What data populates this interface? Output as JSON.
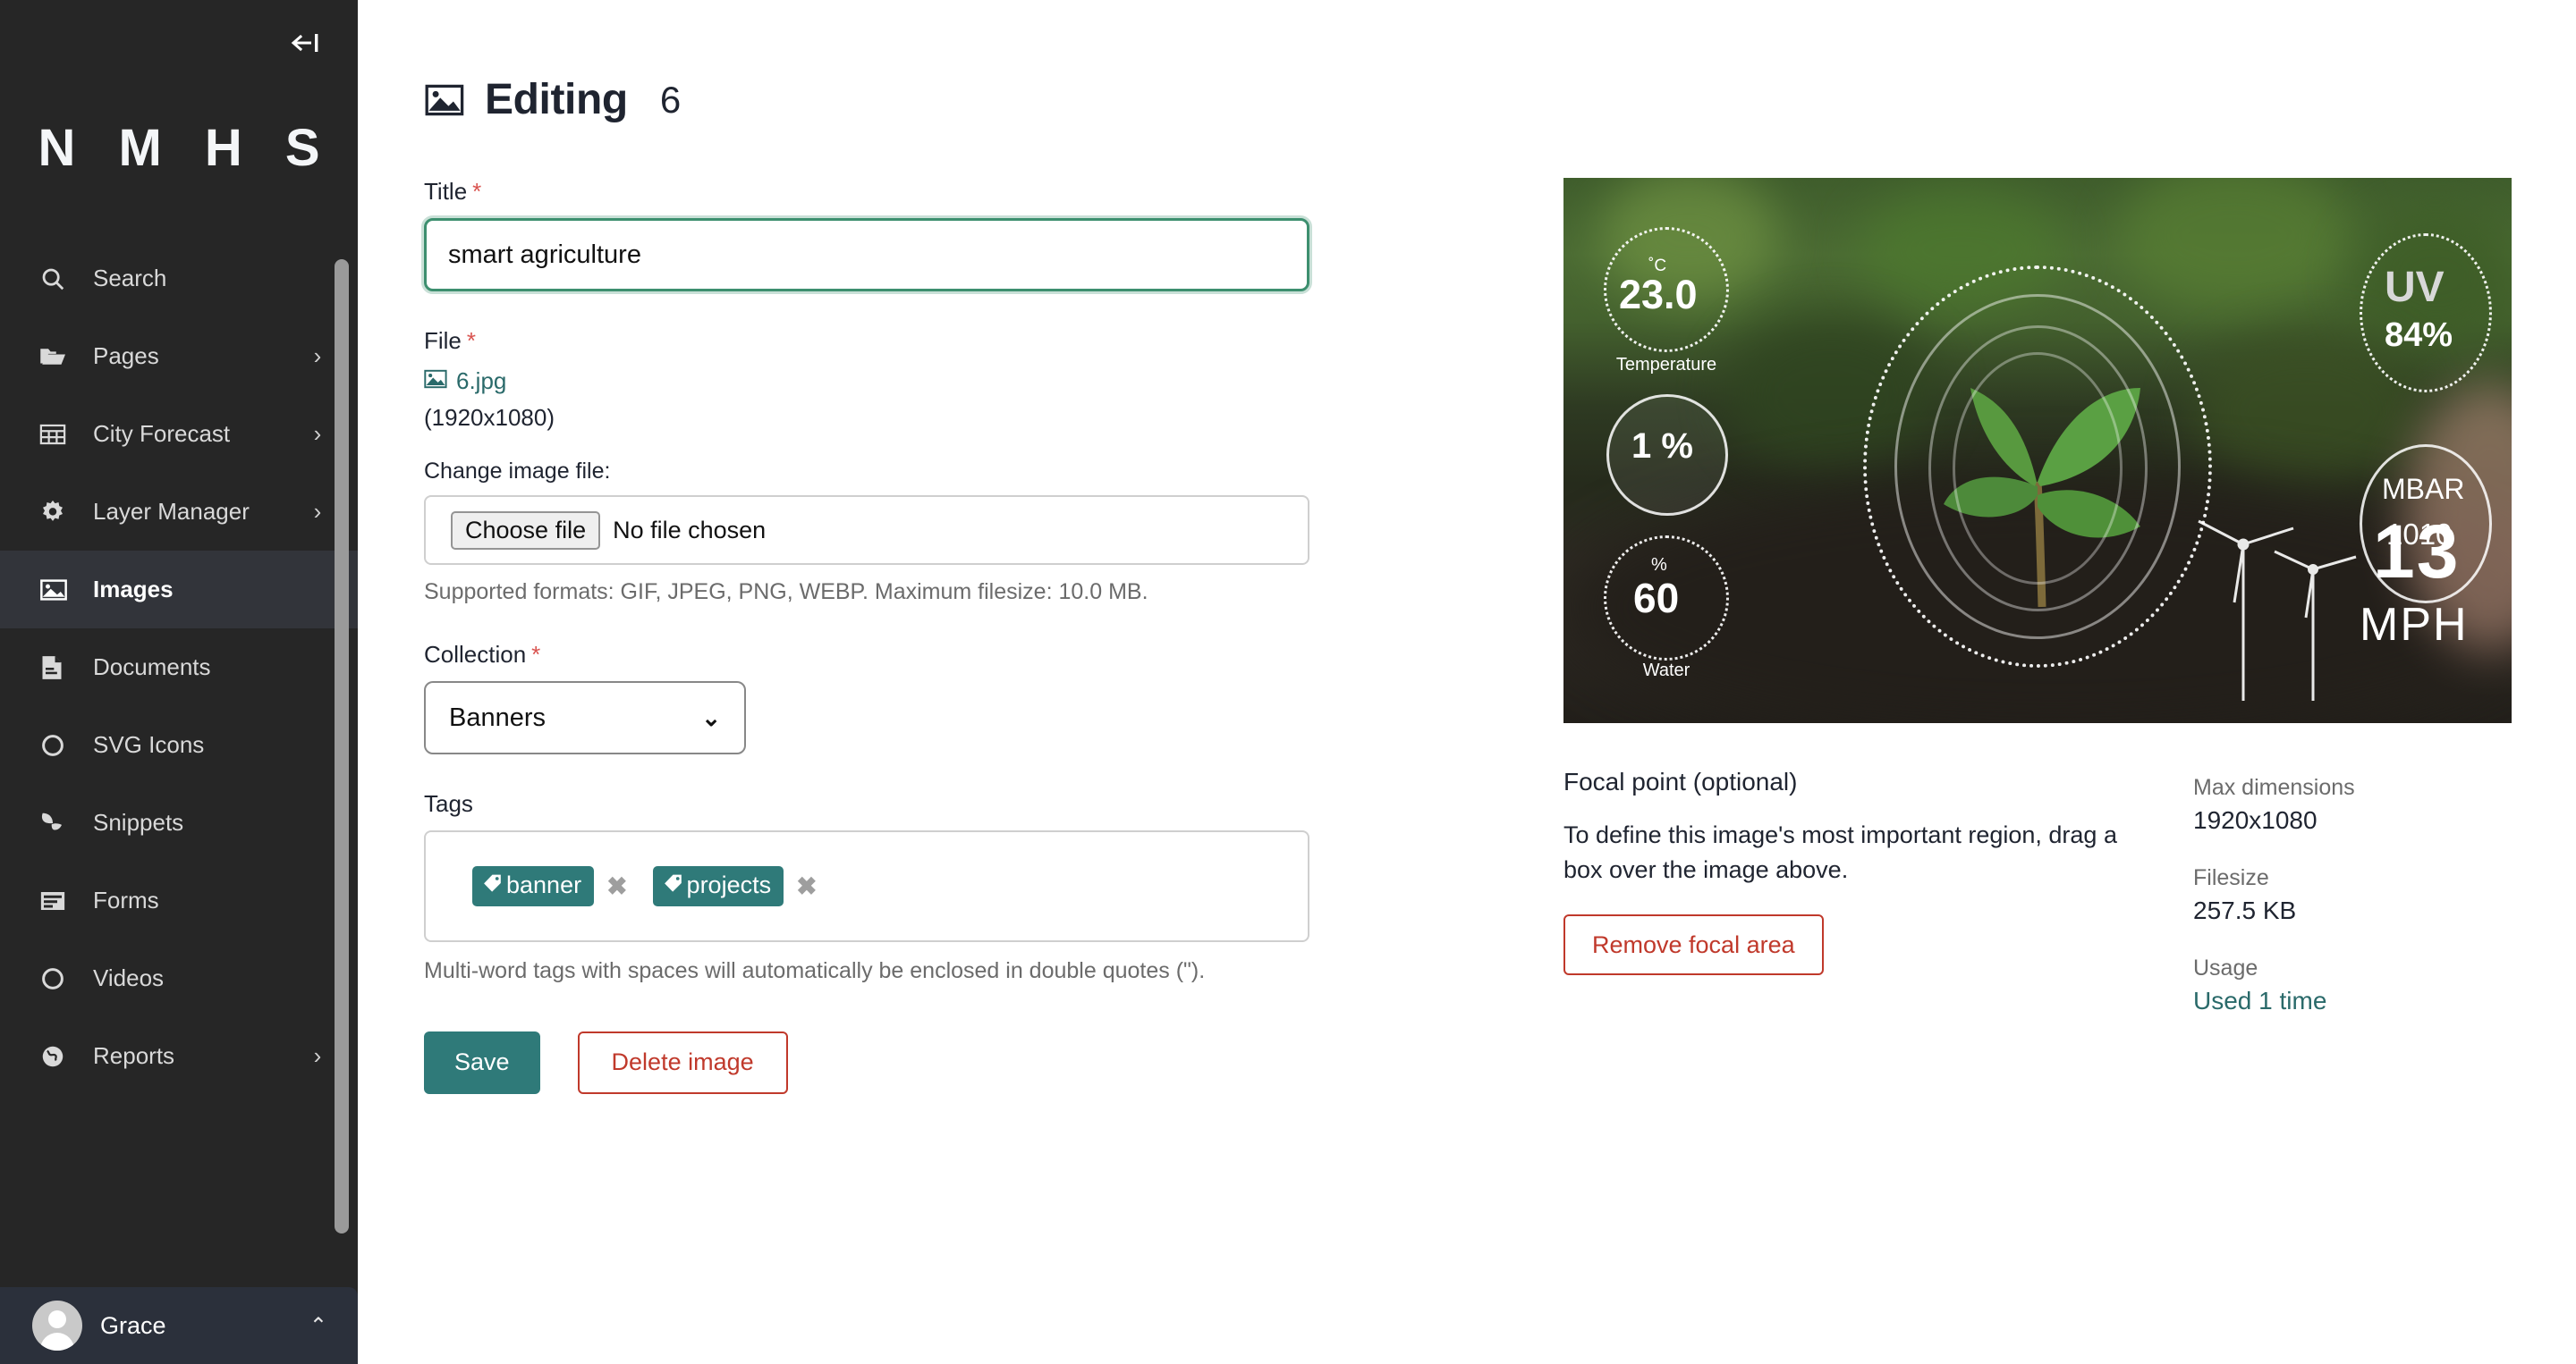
{
  "sidebar": {
    "collapse_icon": "collapse-left-icon",
    "brand": "N M H S",
    "items": [
      {
        "label": "Search",
        "icon": "search-icon",
        "chevron": "",
        "active": false
      },
      {
        "label": "Pages",
        "icon": "folder-open-icon",
        "chevron": "›",
        "active": false
      },
      {
        "label": "City Forecast",
        "icon": "table-icon",
        "chevron": "›",
        "active": false
      },
      {
        "label": "Layer Manager",
        "icon": "gear-icon",
        "chevron": "›",
        "active": false
      },
      {
        "label": "Images",
        "icon": "image-icon",
        "chevron": "",
        "active": true
      },
      {
        "label": "Documents",
        "icon": "document-icon",
        "chevron": "",
        "active": false
      },
      {
        "label": "SVG Icons",
        "icon": "circle-icon",
        "chevron": "",
        "active": false
      },
      {
        "label": "Snippets",
        "icon": "leaf-icon",
        "chevron": "",
        "active": false
      },
      {
        "label": "Forms",
        "icon": "form-icon",
        "chevron": "",
        "active": false
      },
      {
        "label": "Videos",
        "icon": "circle-icon",
        "chevron": "",
        "active": false
      },
      {
        "label": "Reports",
        "icon": "globe-icon",
        "chevron": "›",
        "active": false
      }
    ],
    "user": {
      "name": "Grace",
      "chevron": "⌃",
      "avatar_icon": "avatar-icon"
    }
  },
  "header": {
    "icon": "image-icon",
    "title": "Editing",
    "number": "6"
  },
  "form": {
    "title_label": "Title",
    "title_required": "*",
    "title_value": "smart agriculture",
    "file_label": "File",
    "file_required": "*",
    "file_name": "6.jpg",
    "file_dimensions": "(1920x1080)",
    "file_icon": "image-icon",
    "change_file_label": "Change image file:",
    "choose_file_button": "Choose file",
    "no_file_chosen": "No file chosen",
    "formats_hint": "Supported formats: GIF, JPEG, PNG, WEBP. Maximum filesize: 10.0 MB.",
    "collection_label": "Collection",
    "collection_required": "*",
    "collection_value": "Banners",
    "collection_chevron": "⌄",
    "tags_label": "Tags",
    "tags": [
      {
        "name": "banner",
        "remove": "✖",
        "icon": "tag-icon"
      },
      {
        "name": "projects",
        "remove": "✖",
        "icon": "tag-icon"
      }
    ],
    "tags_hint": "Multi-word tags with spaces will automatically be enclosed in double quotes (\").",
    "save_button": "Save",
    "delete_button": "Delete image"
  },
  "preview": {
    "alt": "smart agriculture seedling with sensor HUD overlay",
    "gauges": [
      {
        "unit": "˚C",
        "value": "23.0",
        "caption": "Temperature"
      },
      {
        "unit": "",
        "value": "1 %",
        "caption": ""
      },
      {
        "unit": "%",
        "value": "60",
        "caption": "Water"
      },
      {
        "unit": "UV",
        "value": "84%",
        "caption": ""
      },
      {
        "unit": "MBAR",
        "value": "1010",
        "caption": ""
      }
    ],
    "wind": {
      "value": "13",
      "unit": "MPH"
    }
  },
  "focal": {
    "title": "Focal point",
    "title_suffix": " (optional)",
    "description": "To define this image's most important region, drag a box over the image above.",
    "remove_button": "Remove focal area"
  },
  "meta": {
    "max_dimensions_label": "Max dimensions",
    "max_dimensions_value": "1920x1080",
    "filesize_label": "Filesize",
    "filesize_value": "257.5 KB",
    "usage_label": "Usage",
    "usage_value": "Used 1 time"
  },
  "colors": {
    "sidebar_bg": "#262626",
    "sidebar_active": "#32343a",
    "user_bg": "#2b303b",
    "accent_teal": "#2f7a79",
    "focus_green": "#3d8f6f",
    "danger_red": "#c0392b",
    "link_teal": "#2a6a6a",
    "required_red": "#d9534f"
  }
}
